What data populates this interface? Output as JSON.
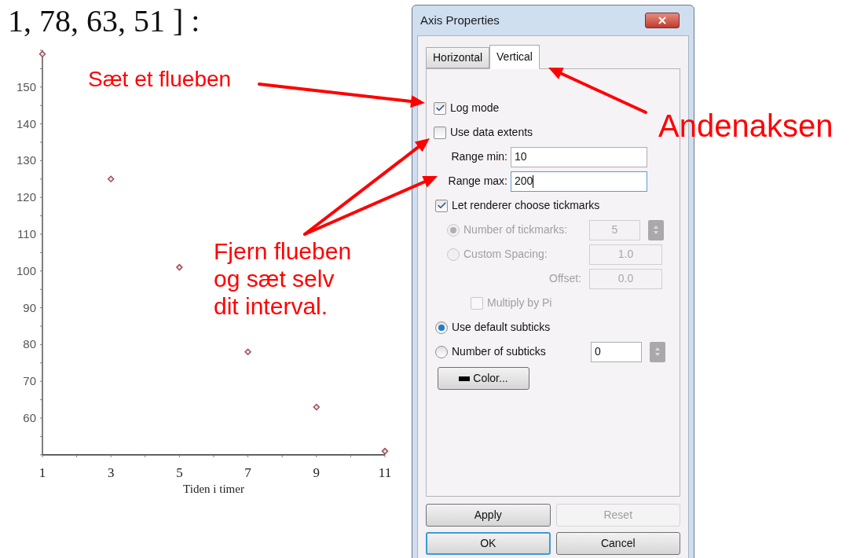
{
  "expression": {
    "text": "1, 78, 63, 51 ] :"
  },
  "plot": {
    "chart_data": {
      "type": "scatter",
      "xlabel": "Tiden i timer",
      "x": [
        1,
        3,
        5,
        7,
        9,
        11
      ],
      "series": [
        {
          "color": "#a0505a",
          "values": [
            159,
            125,
            101,
            78,
            63,
            51
          ]
        }
      ],
      "xlim": [
        1,
        11
      ],
      "ylim": [
        50,
        160
      ],
      "xticks": [
        1,
        3,
        5,
        7,
        9,
        11
      ],
      "yticks": [
        60,
        70,
        80,
        90,
        100,
        110,
        120,
        130,
        140,
        150
      ]
    }
  },
  "dialog": {
    "title": "Axis Properties",
    "tabs": [
      {
        "label": "Horizontal",
        "selected": false
      },
      {
        "label": "Vertical",
        "selected": true
      }
    ],
    "controls": [
      {
        "kind": "checkbox",
        "label": "Log mode",
        "checked": true,
        "disabled": false
      },
      {
        "kind": "checkbox",
        "label": "Use data extents",
        "checked": false,
        "disabled": false
      },
      {
        "kind": "field",
        "label": "Range min:",
        "value": "10",
        "focused": false,
        "disabled": false
      },
      {
        "kind": "field",
        "label": "Range max:",
        "value": "200",
        "focused": true,
        "disabled": false
      },
      {
        "kind": "checkbox",
        "label": "Let renderer choose tickmarks",
        "checked": true,
        "disabled": false
      },
      {
        "kind": "radio",
        "label": "Number of tickmarks:",
        "selected": true,
        "disabled": true,
        "value": "5",
        "spinner": true
      },
      {
        "kind": "radio",
        "label": "Custom Spacing:",
        "selected": false,
        "disabled": true,
        "value": "1.0"
      },
      {
        "kind": "field",
        "label": "Offset:",
        "value": "0.0",
        "focused": false,
        "disabled": true
      },
      {
        "kind": "checkbox",
        "label": "Multiply by Pi",
        "checked": false,
        "disabled": true
      },
      {
        "kind": "radio",
        "label": "Use default subticks",
        "selected": true,
        "disabled": false
      },
      {
        "kind": "radio",
        "label": "Number of subticks",
        "selected": false,
        "disabled": false,
        "value": "0",
        "spinner": true
      },
      {
        "kind": "button",
        "label": "Color..."
      }
    ],
    "buttons": [
      {
        "label": "Apply",
        "disabled": false,
        "focused": false
      },
      {
        "label": "Reset",
        "disabled": true,
        "focused": false
      },
      {
        "label": "OK",
        "disabled": false,
        "focused": true
      },
      {
        "label": "Cancel",
        "disabled": false,
        "focused": false
      }
    ]
  },
  "callouts": [
    {
      "text": "Sæt et flueben"
    },
    {
      "text": "Andenaksen"
    },
    {
      "text": "Fjern flueben og sæt selv dit interval."
    }
  ]
}
